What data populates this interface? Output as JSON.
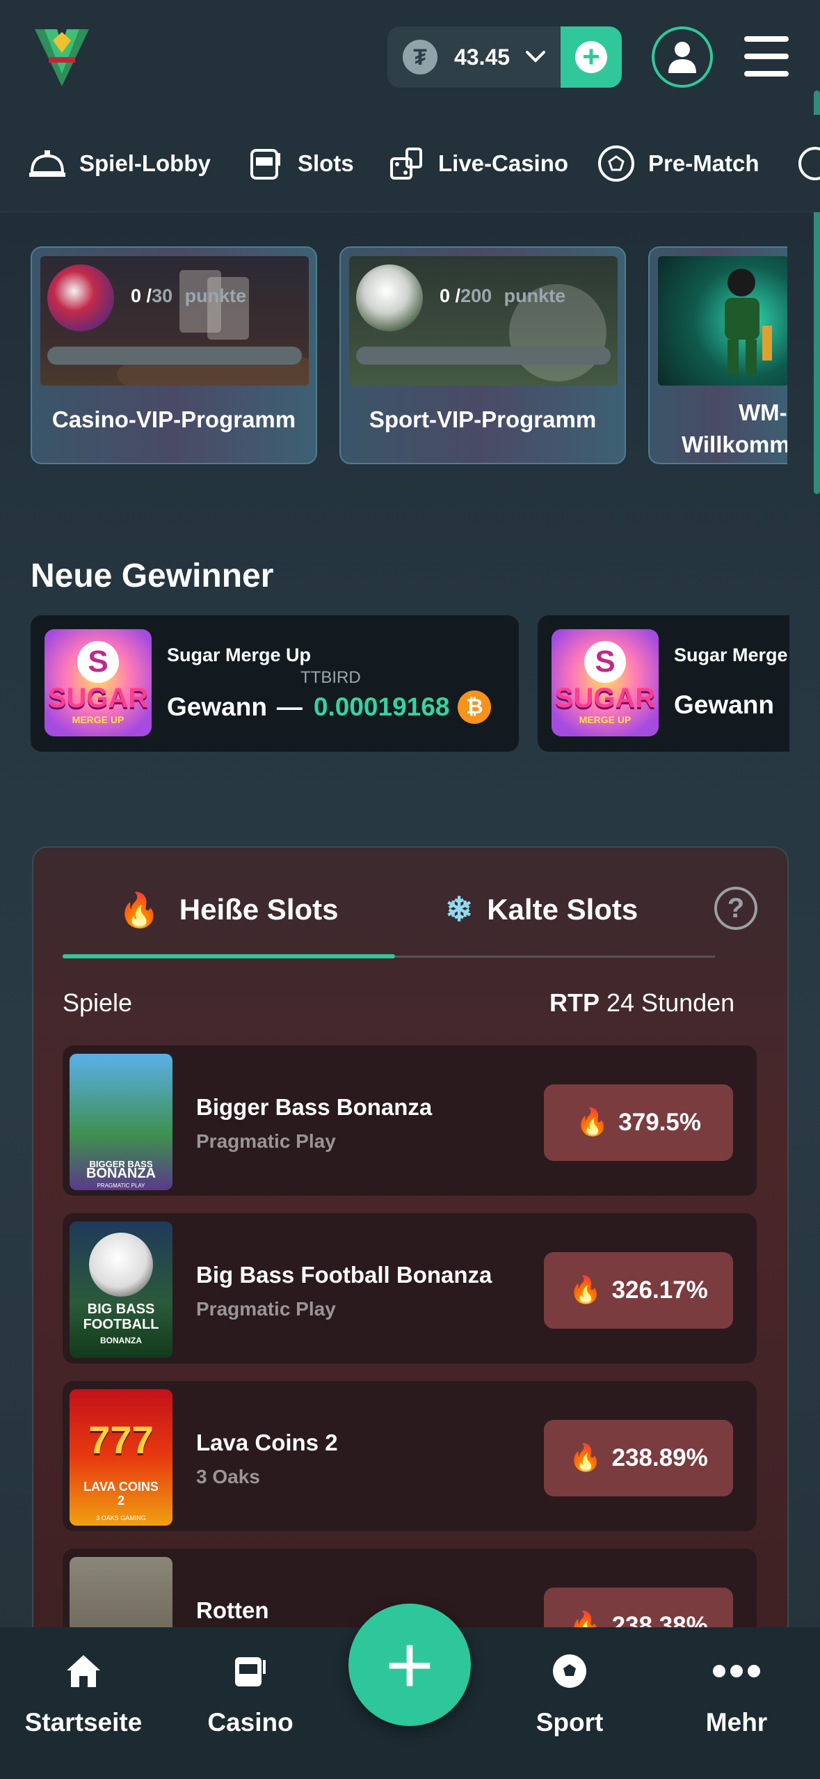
{
  "header": {
    "balance": "43.45",
    "currency_symbol": "₮",
    "wallet_icon": "tether-coin-icon",
    "accent_color": "#30c89a"
  },
  "nav": {
    "items": [
      {
        "label": "Spiel-Lobby",
        "icon": "service-bell-icon"
      },
      {
        "label": "Slots",
        "icon": "slot-machine-icon"
      },
      {
        "label": "Live-Casino",
        "icon": "cards-dice-icon"
      },
      {
        "label": "Pre-Match",
        "icon": "soccer-ball-icon"
      }
    ]
  },
  "vip": {
    "cards": [
      {
        "current": "0",
        "sep": "/",
        "target": "30",
        "unit": "punkte",
        "title": "Casino-VIP-Programm"
      },
      {
        "current": "0",
        "sep": "/",
        "target": "200",
        "unit": "punkte",
        "title": "Sport-VIP-Programm"
      },
      {
        "title_line1": "WM-",
        "title_line2": "Willkomm"
      }
    ]
  },
  "winners": {
    "title": "Neue Gewinner",
    "items": [
      {
        "game": "Sugar Merge Up",
        "user": "TTBIRD",
        "won_label": "Gewann",
        "dash": "—",
        "amount": "0.00019168",
        "coin": "₿"
      },
      {
        "game": "Sugar Merge",
        "won_label": "Gewann"
      }
    ],
    "thumb_text1": "SUGAR",
    "thumb_text2": "MERGE UP",
    "thumb_letter": "S"
  },
  "slots": {
    "tab_hot": "Heiße Slots",
    "tab_cold": "Kalte Slots",
    "help": "?",
    "col_games": "Spiele",
    "col_rtp_bold": "RTP",
    "col_rtp_rest": "24 Stunden",
    "rows": [
      {
        "name": "Bigger Bass Bonanza",
        "provider": "Pragmatic Play",
        "rtp": "379.5%",
        "thumb1": "BIGGER BASS",
        "thumb2": "BONANZA",
        "thumb3": "PRAGMATIC PLAY"
      },
      {
        "name": "Big Bass Football Bonanza",
        "provider": "Pragmatic Play",
        "rtp": "326.17%",
        "thumb1": "BIG BASS",
        "thumb2": "FOOTBALL",
        "thumb3": "BONANZA"
      },
      {
        "name": "Lava Coins 2",
        "provider": "3 Oaks",
        "rtp": "238.89%",
        "thumb1": "777",
        "thumb2": "LAVA COINS 2",
        "thumb3": "3 OAKS GAMING"
      },
      {
        "name": "Rotten",
        "provider": "",
        "rtp": "238.38%"
      }
    ]
  },
  "bottom_nav": {
    "home": "Startseite",
    "casino": "Casino",
    "sport": "Sport",
    "more": "Mehr",
    "fab": "+"
  }
}
